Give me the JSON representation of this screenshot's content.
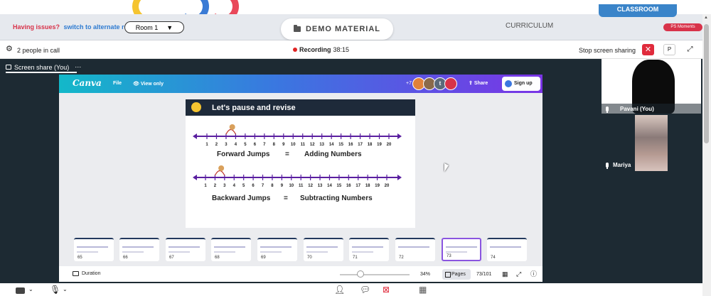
{
  "topbar": {
    "issues_label": "Having issues?",
    "alternate_room_link": "switch to alternate room",
    "room_select": "Room 1",
    "demo_material": "DEMO MATERIAL",
    "curriculum_tab": "CURRICULUM",
    "classroom_tab": "CLASSROOM",
    "ps_moments": "PS Moments"
  },
  "callbar": {
    "people_in_call": "2 people in call",
    "recording_label": "Recording",
    "recording_time": "38:15",
    "stop_sharing": "Stop screen sharing",
    "p_label": "P"
  },
  "share_tab": {
    "label": "Screen share (You)",
    "more": "⋯"
  },
  "canva": {
    "logo": "Canva",
    "file": "File",
    "view_only": "View only",
    "collab_count": "+7",
    "avatar_t": "t",
    "share": "Share",
    "sign_up": "Sign up"
  },
  "slide": {
    "title": "Let's pause and revise",
    "forward_left": "Forward Jumps",
    "forward_eq": "=",
    "forward_right": "Adding Numbers",
    "backward_left": "Backward Jumps",
    "backward_eq": "=",
    "backward_right": "Subtracting Numbers",
    "numbers": [
      "1",
      "2",
      "3",
      "4",
      "5",
      "6",
      "7",
      "8",
      "9",
      "10",
      "11",
      "12",
      "13",
      "14",
      "15",
      "16",
      "17",
      "18",
      "19",
      "20"
    ]
  },
  "thumbnails": [
    {
      "num": "65"
    },
    {
      "num": "66"
    },
    {
      "num": "67"
    },
    {
      "num": "68"
    },
    {
      "num": "69"
    },
    {
      "num": "70"
    },
    {
      "num": "71"
    },
    {
      "num": "72"
    },
    {
      "num": "73"
    },
    {
      "num": "74"
    }
  ],
  "canva_footer": {
    "duration": "Duration",
    "zoom": "34%",
    "pages": "Pages",
    "page_count": "73/101",
    "zoom_fraction": 0.3
  },
  "participants": [
    {
      "name": "Pavani (You)"
    },
    {
      "name": "Mariya"
    }
  ],
  "colors": {
    "stage_bg": "#1d2a33",
    "accent_red": "#e02b3c",
    "classroom_blue": "#3a84c9",
    "canva_gradient_start": "#13b8c9",
    "canva_gradient_end": "#7a34e6",
    "numberline_purple": "#5a1fa0"
  },
  "icons": {
    "gear": "gear-icon",
    "record": "record-dot-icon",
    "close": "close-icon",
    "expand": "expand-icon",
    "camera": "camera-icon",
    "mic": "mic-icon",
    "person": "person-icon",
    "chat": "chat-icon",
    "screenshare_off": "screen-share-off-icon",
    "grid": "grid-icon"
  }
}
